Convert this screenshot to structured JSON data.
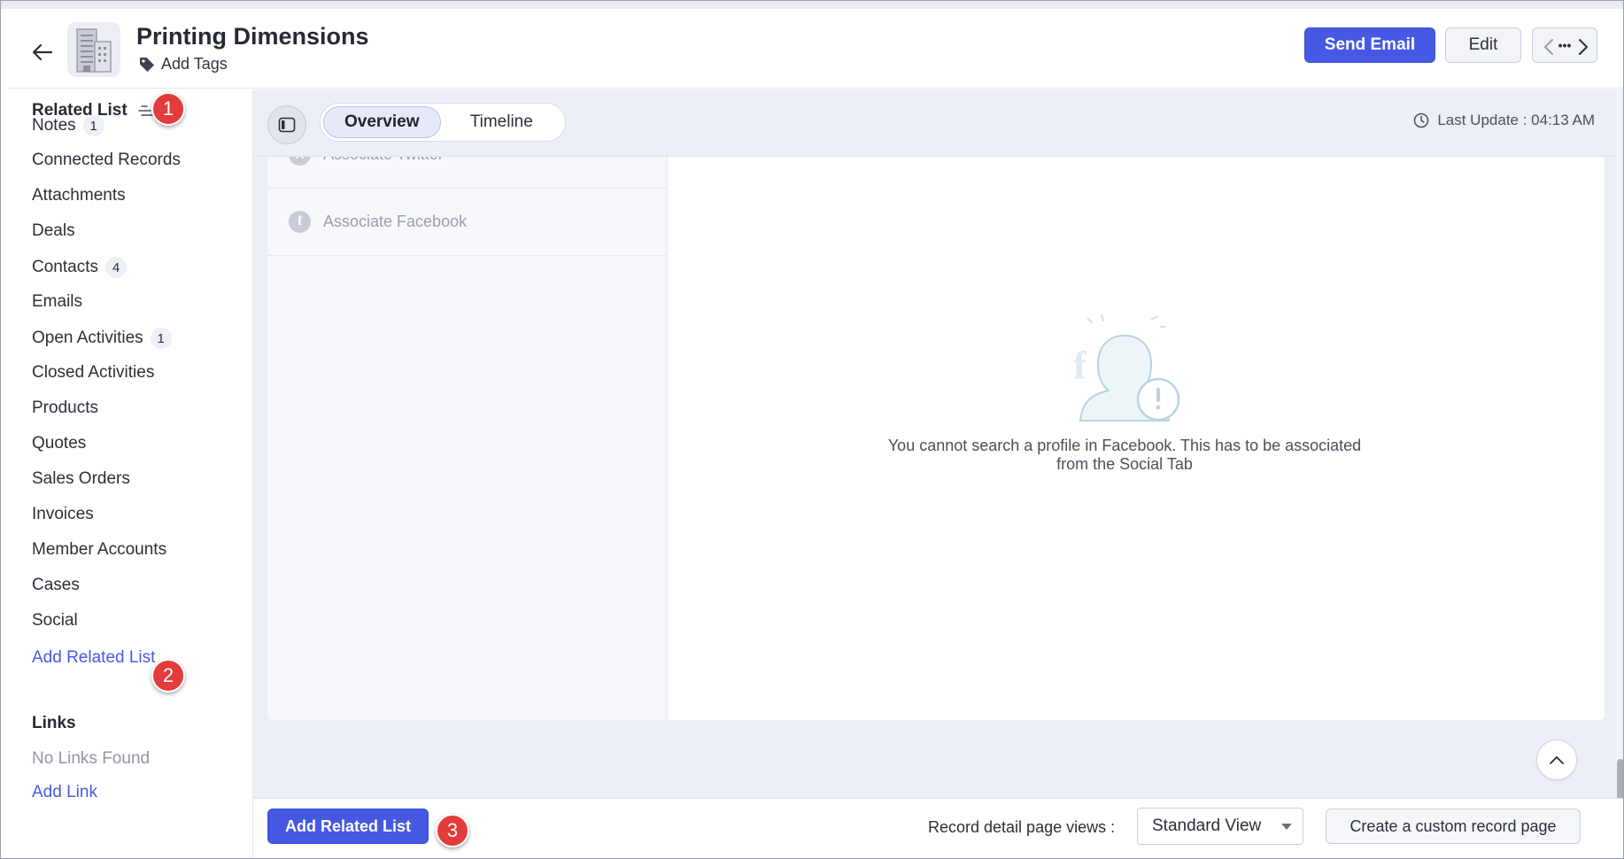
{
  "header": {
    "title": "Printing Dimensions",
    "add_tags": "Add Tags",
    "send_email": "Send Email",
    "edit": "Edit",
    "more": "•••"
  },
  "sidebar": {
    "heading": "Related List",
    "items": [
      {
        "label": "Notes",
        "count": "1"
      },
      {
        "label": "Connected Records",
        "count": null
      },
      {
        "label": "Attachments",
        "count": null
      },
      {
        "label": "Deals",
        "count": null
      },
      {
        "label": "Contacts",
        "count": "4"
      },
      {
        "label": "Emails",
        "count": null
      },
      {
        "label": "Open Activities",
        "count": "1"
      },
      {
        "label": "Closed Activities",
        "count": null
      },
      {
        "label": "Products",
        "count": null
      },
      {
        "label": "Quotes",
        "count": null
      },
      {
        "label": "Sales Orders",
        "count": null
      },
      {
        "label": "Invoices",
        "count": null
      },
      {
        "label": "Member Accounts",
        "count": null
      },
      {
        "label": "Cases",
        "count": null
      },
      {
        "label": "Social",
        "count": null
      }
    ],
    "add_related_list": "Add Related List",
    "links_heading": "Links",
    "no_links": "No Links Found",
    "add_link": "Add Link"
  },
  "main": {
    "tabs": [
      {
        "label": "Overview",
        "active": true
      },
      {
        "label": "Timeline",
        "active": false
      }
    ],
    "last_update": "Last Update : 04:13 AM",
    "social": {
      "associate_twitter": "Associate Twitter",
      "associate_facebook": "Associate Facebook",
      "empty_message": "You cannot search a profile in Facebook. This has to be associated from the Social Tab"
    }
  },
  "footer": {
    "add_related_list": "Add Related List",
    "views_label": "Record detail page views :",
    "view_selected": "Standard View",
    "create_custom": "Create a custom record page"
  },
  "annotations": [
    "1",
    "2",
    "3"
  ],
  "colors": {
    "primary": "#4659e3",
    "link": "#4659e3",
    "marker": "#e43b3b",
    "panel_bg": "#eceff6"
  }
}
